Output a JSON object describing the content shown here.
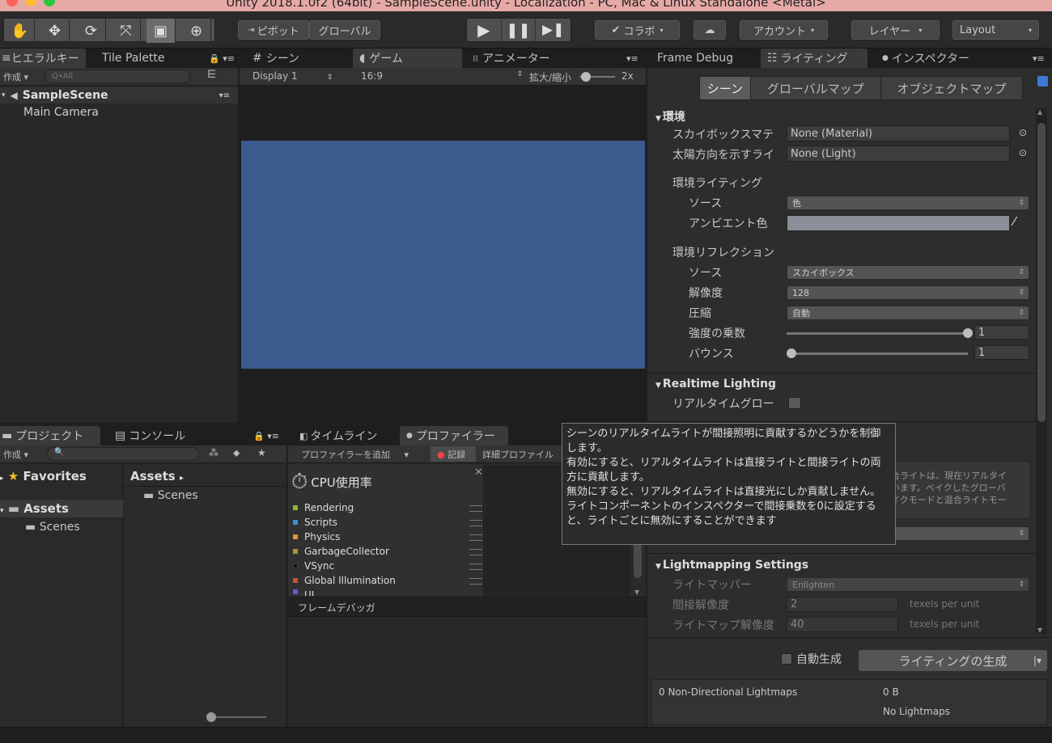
{
  "window": {
    "title": "Unity 2018.1.0f2 (64bit) - SampleScene.unity - Localization - PC, Mac & Linux Standalone <Metal>",
    "colors": {
      "close": "#ff5f57",
      "minimize": "#febc2e",
      "zoom": "#28c840",
      "titlebar": "#e7a9a6"
    }
  },
  "toolbar": {
    "tools": [
      "hand-icon",
      "move-icon",
      "rotate-icon",
      "scale-icon",
      "rect-icon",
      "transform-icon"
    ],
    "pivot": "ピボット",
    "global": "グローバル",
    "collab": "コラボ",
    "account": "アカウント",
    "layers": "レイヤー",
    "layout": "Layout"
  },
  "hierarchy": {
    "tabs": [
      "ヒエラルキー",
      "Tile Palette"
    ],
    "create": "作成",
    "search_placeholder": "Q•All",
    "scene": "SampleScene",
    "items": [
      "Main Camera"
    ]
  },
  "center": {
    "tabs": [
      "シーン",
      "ゲーム",
      "アニメーター"
    ],
    "display": "Display 1",
    "aspect": "16:9",
    "scale_label": "拡大/縮小",
    "scale_value": "2x",
    "game_color": "#3d5a8f"
  },
  "project": {
    "tabs": [
      "プロジェクト",
      "コンソール"
    ],
    "create": "作成",
    "favorites": "Favorites",
    "assets": "Assets",
    "scenes": "Scenes",
    "breadcrumb": "Assets",
    "right_items": [
      "Scenes"
    ]
  },
  "profiler": {
    "tabs": [
      "タイムライン",
      "プロファイラー"
    ],
    "add": "プロファイラーを追加",
    "record": "記録",
    "deep": "詳細プロファイル",
    "cpu": "CPU使用率",
    "legend": [
      {
        "name": "Rendering",
        "color": "#8fb530"
      },
      {
        "name": "Scripts",
        "color": "#3b8fd1"
      },
      {
        "name": "Physics",
        "color": "#e8912f"
      },
      {
        "name": "GarbageCollector",
        "color": "#a69a2f"
      },
      {
        "name": "VSync",
        "color": "#101010"
      },
      {
        "name": "Global Illumination",
        "color": "#c8532c"
      },
      {
        "name": "UI",
        "color": "#6a5acd"
      }
    ],
    "frame_debugger_tab": "フレームデバッガ"
  },
  "lighting": {
    "tabs": [
      "Frame Debug",
      "ライティング",
      "インスペクター"
    ],
    "subtabs": [
      "シーン",
      "グローバルマップ",
      "オブジェクトマップ"
    ],
    "environment": {
      "header": "環境",
      "skybox_label": "スカイボックスマテ",
      "skybox_value": "None (Material)",
      "sun_label": "太陽方向を示すライ",
      "sun_value": "None (Light)",
      "env_lighting": "環境ライティング",
      "source_label": "ソース",
      "source_value": "色",
      "ambient_label": "アンビエント色",
      "ambient_color": "#8a8f99",
      "env_reflection": "環境リフレクション",
      "refl_source_label": "ソース",
      "refl_source_value": "スカイボックス",
      "resolution_label": "解像度",
      "resolution_value": "128",
      "compression_label": "圧縮",
      "compression_value": "自動",
      "intensity_label": "強度の乗数",
      "intensity_value": "1",
      "bounce_label": "バウンス",
      "bounce_value": "1"
    },
    "realtime": {
      "header": "Realtime Lighting",
      "gi_label": "リアルタイムグロー",
      "hidden_text": "合ライトは、現在リアルタイ\nいます。ベイクしたグローバ\nイクモードと混合ライトモー"
    },
    "lightmapping": {
      "header": "Lightmapping Settings",
      "lightmapper_label": "ライトマッパー",
      "lightmapper_value": "Enlighten",
      "indirect_label": "間接解像度",
      "indirect_value": "2",
      "indirect_unit": "texels per unit",
      "lm_res_label": "ライトマップ解像度",
      "lm_res_value": "40",
      "lm_res_unit": "texels per unit"
    },
    "auto_generate": "自動生成",
    "generate": "ライティングの生成",
    "stats_left": "0 Non-Directional Lightmaps",
    "stats_size": "0 B",
    "stats_none": "No Lightmaps"
  },
  "tooltip": {
    "text": "シーンのリアルタイムライトが間接照明に貢献するかどうかを制御します。\n有効にすると、リアルタイムライトは直接ライトと間接ライトの両方に貢献します。\n無効にすると、リアルタイムライトは直接光にしか貢献しません。ライトコンポーネントのインスペクターで間接乗数を0に設定すると、ライトごとに無効にすることができます"
  }
}
